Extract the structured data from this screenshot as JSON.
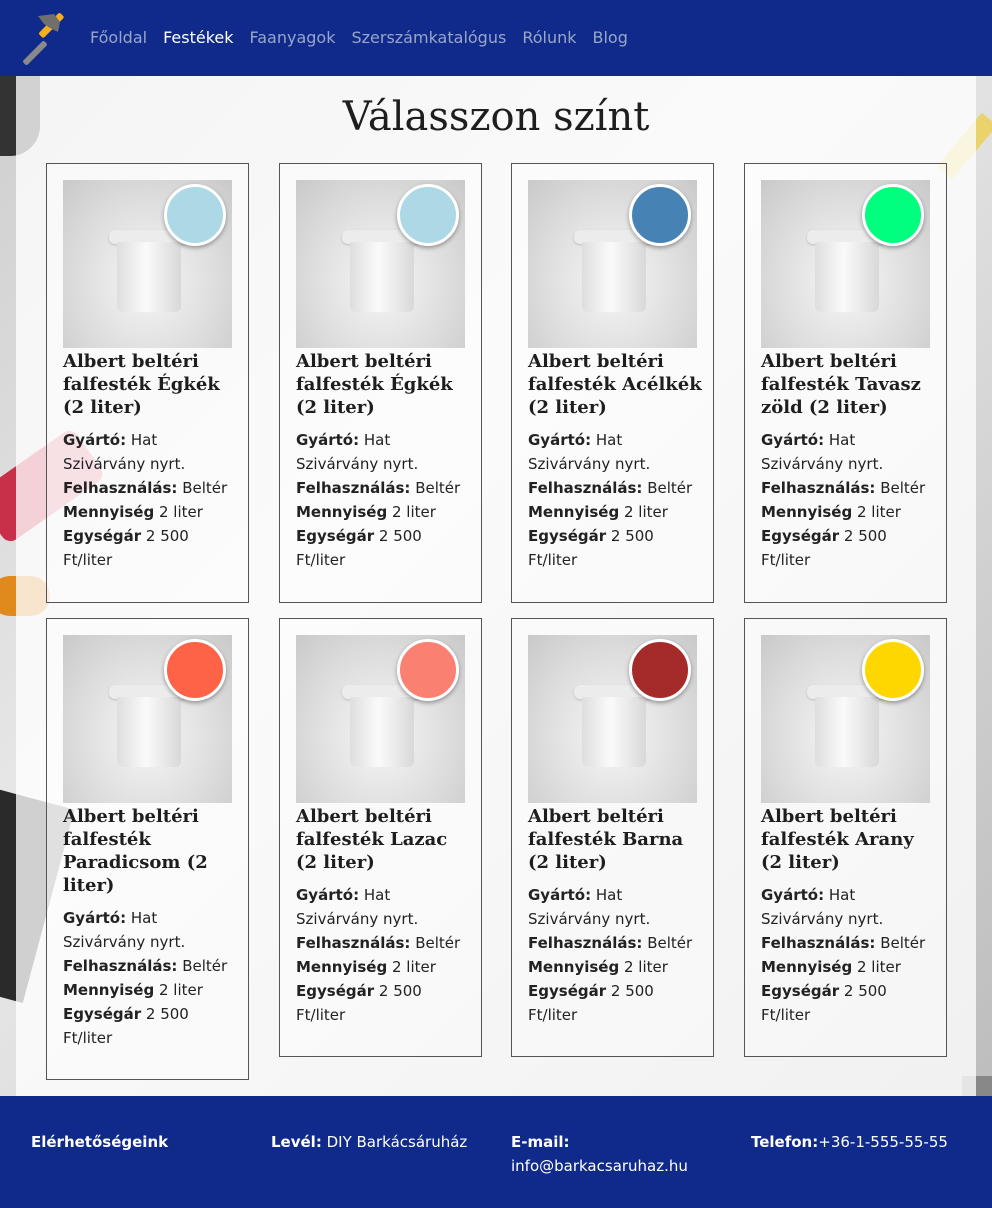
{
  "nav": {
    "items": [
      "Főoldal",
      "Festékek",
      "Faanyagok",
      "Szerszámkatalógus",
      "Rólunk",
      "Blog"
    ],
    "active": "Festékek"
  },
  "page": {
    "title": "Válasszon színt"
  },
  "labels": {
    "manufacturer": "Gyártó:",
    "usage": "Felhasználás:",
    "quantity": "Mennyiség",
    "unit_price": "Egységár"
  },
  "products": [
    {
      "name": "Albert beltéri falfesték Égkék (2 liter)",
      "color": "#add8e6",
      "manufacturer": "Hat Szivárvány nyrt.",
      "usage": "Beltér",
      "quantity": "2 liter",
      "unit_price": "2 500 Ft/liter"
    },
    {
      "name": "Albert beltéri falfesték Égkék (2 liter)",
      "color": "#add8e6",
      "manufacturer": "Hat Szivárvány nyrt.",
      "usage": "Beltér",
      "quantity": "2 liter",
      "unit_price": "2 500 Ft/liter"
    },
    {
      "name": "Albert beltéri falfesték Acélkék (2 liter)",
      "color": "#4682b4",
      "manufacturer": "Hat Szivárvány nyrt.",
      "usage": "Beltér",
      "quantity": "2 liter",
      "unit_price": "2 500 Ft/liter"
    },
    {
      "name": "Albert beltéri falfesték Tavasz zöld (2 liter)",
      "color": "#00ff7f",
      "manufacturer": "Hat Szivárvány nyrt.",
      "usage": "Beltér",
      "quantity": "2 liter",
      "unit_price": "2 500 Ft/liter"
    },
    {
      "name": "Albert beltéri falfesték Paradicsom (2 liter)",
      "color": "#ff6347",
      "manufacturer": "Hat Szivárvány nyrt.",
      "usage": "Beltér",
      "quantity": "2 liter",
      "unit_price": "2 500 Ft/liter"
    },
    {
      "name": "Albert beltéri falfesték Lazac (2 liter)",
      "color": "#fa8072",
      "manufacturer": "Hat Szivárvány nyrt.",
      "usage": "Beltér",
      "quantity": "2 liter",
      "unit_price": "2 500 Ft/liter"
    },
    {
      "name": "Albert beltéri falfesték Barna (2 liter)",
      "color": "#a52a2a",
      "manufacturer": "Hat Szivárvány nyrt.",
      "usage": "Beltér",
      "quantity": "2 liter",
      "unit_price": "2 500 Ft/liter"
    },
    {
      "name": "Albert beltéri falfesték Arany (2 liter)",
      "color": "#ffd700",
      "manufacturer": "Hat Szivárvány nyrt.",
      "usage": "Beltér",
      "quantity": "2 liter",
      "unit_price": "2 500 Ft/liter"
    }
  ],
  "footer": {
    "heading": "Elérhetőségeink",
    "mail_label": "Levél:",
    "mail_value": "DIY Barkácsáruház",
    "email_label": "E-mail:",
    "email_value": "info@barkacsaruhaz.hu",
    "phone_label": "Telefon:",
    "phone_value": "+36-1-555-55-55"
  },
  "colors": {
    "header_bg": "#0f2a8a",
    "nav_active": "#ffffff",
    "nav_inactive": "#9aa6c8"
  }
}
